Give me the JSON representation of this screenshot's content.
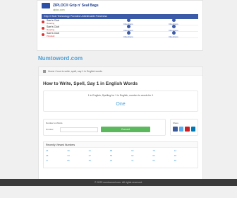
{
  "ad": {
    "title": "ZIPLOC® Grip n' Seal Bags",
    "url": "ziploc.com",
    "banner": "Grip n' Seal Technology Provides Unbelievable Freshness",
    "rows": [
      {
        "name": "Sam's Club",
        "sub": "Reading",
        "dir": "Directions"
      },
      {
        "name": "Sam's Club",
        "sub": "Reading",
        "dir": "Directions"
      },
      {
        "name": "Sam's Club",
        "sub": "Pittsfield",
        "dir": "Directions"
      }
    ]
  },
  "brand": "Numtoword.com",
  "breadcrumb": "Home / how to write, spell, say 1 in English words",
  "page_title": "How to Write, Spell, Say 1 in English Words",
  "result": {
    "label": "1 in English, Spelling for 1 in English, number to words for 1",
    "word": "One"
  },
  "converter": {
    "heading": "Number to Words",
    "input_label": "Number",
    "submit_label": "Convert"
  },
  "share": {
    "heading": "Share",
    "icons": [
      {
        "name": "facebook-icon",
        "color": "#3b5998"
      },
      {
        "name": "twitter-icon",
        "color": "#55acee"
      },
      {
        "name": "pinterest-icon",
        "color": "#cb2027"
      },
      {
        "name": "linkedin-icon",
        "color": "#0077b5"
      }
    ]
  },
  "recent": {
    "heading": "Recently Viewed Numbers",
    "numbers": [
      "45",
      "39",
      "21",
      "88",
      "63",
      "78",
      "12",
      "48",
      "34",
      "27",
      "56",
      "92",
      "64",
      "45",
      "17",
      "85",
      "49",
      "23",
      "37",
      "53",
      "66"
    ]
  },
  "footer": "© 2023 numtoword.com. All rights reserved."
}
